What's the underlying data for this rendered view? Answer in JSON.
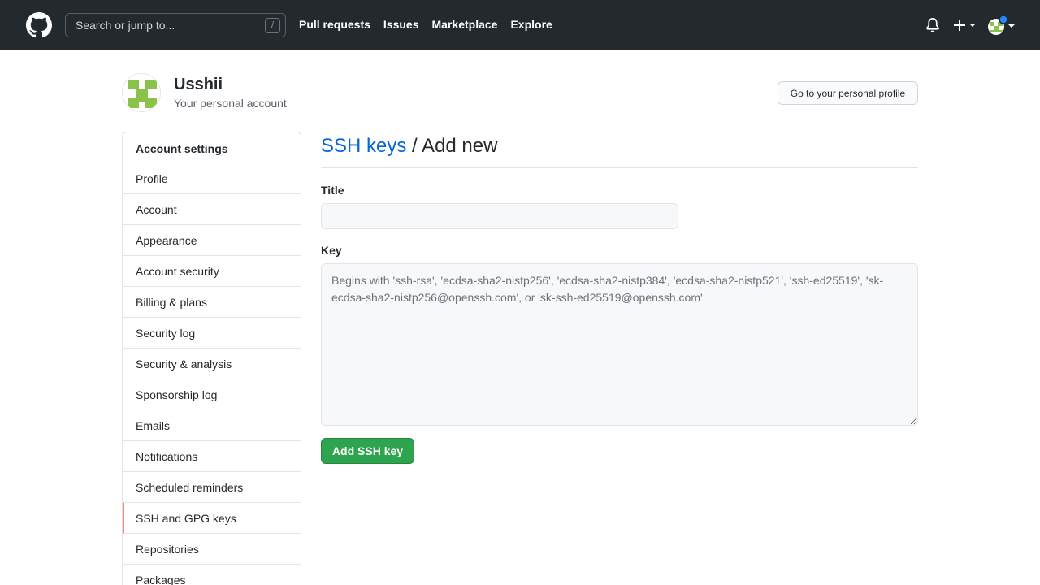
{
  "header": {
    "search_placeholder": "Search or jump to...",
    "search_shortcut": "/",
    "nav": [
      "Pull requests",
      "Issues",
      "Marketplace",
      "Explore"
    ],
    "icons": [
      "github-logo-icon",
      "bell-icon",
      "plus-icon",
      "chevron-down-icon"
    ]
  },
  "profile": {
    "name": "Usshii",
    "subtitle": "Your personal account",
    "profile_button": "Go to your personal profile"
  },
  "sidebar": {
    "heading": "Account settings",
    "items": [
      {
        "label": "Profile"
      },
      {
        "label": "Account"
      },
      {
        "label": "Appearance"
      },
      {
        "label": "Account security"
      },
      {
        "label": "Billing & plans"
      },
      {
        "label": "Security log"
      },
      {
        "label": "Security & analysis"
      },
      {
        "label": "Sponsorship log"
      },
      {
        "label": "Emails"
      },
      {
        "label": "Notifications"
      },
      {
        "label": "Scheduled reminders"
      },
      {
        "label": "SSH and GPG keys",
        "active": true
      },
      {
        "label": "Repositories"
      },
      {
        "label": "Packages"
      }
    ]
  },
  "main": {
    "breadcrumb_link": "SSH keys",
    "breadcrumb_rest": " / Add new",
    "title_label": "Title",
    "title_value": "",
    "key_label": "Key",
    "key_placeholder": "Begins with 'ssh-rsa', 'ecdsa-sha2-nistp256', 'ecdsa-sha2-nistp384', 'ecdsa-sha2-nistp521', 'ssh-ed25519', 'sk-ecdsa-sha2-nistp256@openssh.com', or 'sk-ssh-ed25519@openssh.com'",
    "submit_label": "Add SSH key"
  },
  "colors": {
    "header_bg": "#24292e",
    "link": "#0366d6",
    "primary_button": "#2ea44f",
    "active_marker": "#f9826c",
    "notification_dot": "#2188ff"
  }
}
